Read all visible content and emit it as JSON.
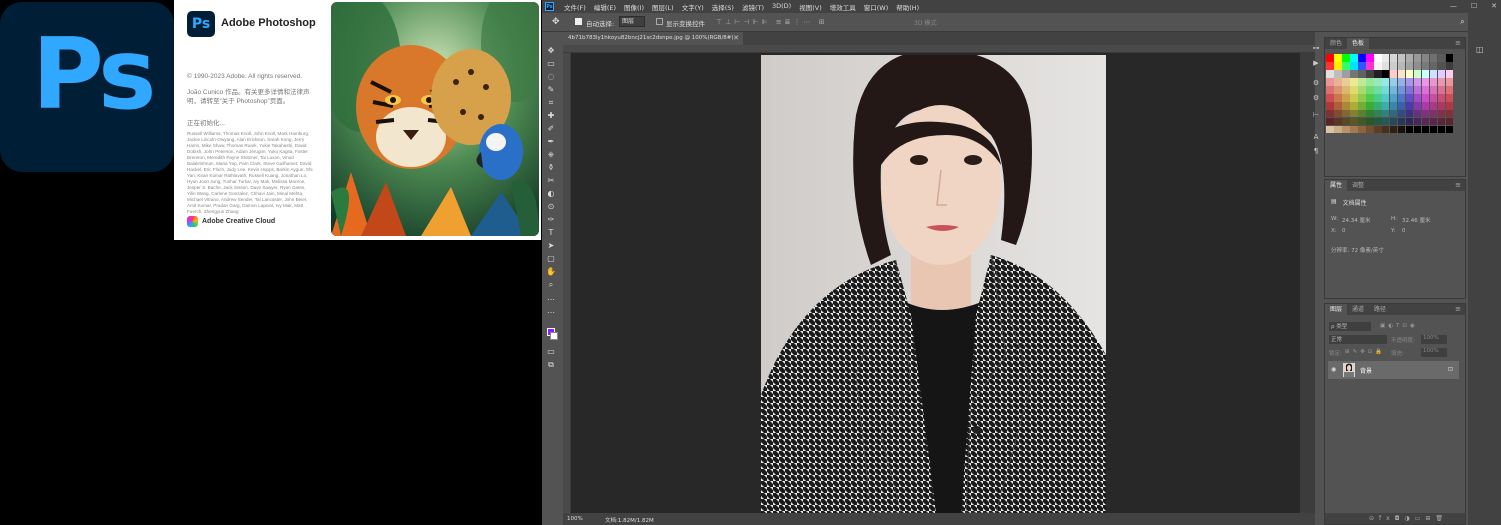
{
  "icon": {
    "text": "Ps",
    "color": "#31a8ff",
    "bg": "#001e36"
  },
  "splash": {
    "logo": "Ps",
    "title": "Adobe Photoshop",
    "copyright": "© 1990-2023 Adobe. All rights reserved.",
    "credit": "João Cunico 作品。有关更多详情和法律声明，请转至“关于 Photoshop”页面。",
    "status": "正在初始化...",
    "names": "Russell Williams, Thomas Knoll, John Knoll, Mark Hamburg, Jackie Lincoln-Owyang, Alan Erickson, Sarah Kong, Jerry Harris, Mike Shaw, Thomas Ruark, Yukie Takahashi, David Dobish, John Peterson, Adam Jerugim, Yuko Kagita, Foster Brereton, Meredith Payne Stotzner, Tai Luxon, Vinod Balakrishnan, Maria Yap, Pam Clark, Steve Guilhamet, David Hackel, Eric Floch, Judy Lee, Kevin Hopps, Barkin Aygun, Shi Yan, Kiran Kumar Rathlavath, Russell Kuang, Jonathan Lo, Hyun Joon Jung, Tushar Turkar, Ivy Mak, Melissa Monroe, Jesper S. Bache, Jack Sisson, Dave Sawyer, Ryan Gates, Yilin Wang, Carlene Gonzalez, Chhavi Jain, Minal Mehta, Michael Vitrano, Andrew Sender, Tal Lancaster, John Beier, Amit Kumar, Pradan Garg, Damon Lapoint, Ivy Mak, Matt Fuerch, Zhengyun Zhang",
    "cc": "Adobe Creative Cloud"
  },
  "menubar": {
    "logo": "Ps",
    "items": [
      "文件(F)",
      "编辑(E)",
      "图像(I)",
      "图层(L)",
      "文字(Y)",
      "选择(S)",
      "滤镜(T)",
      "3D(D)",
      "视图(V)",
      "增效工具",
      "窗口(W)",
      "帮助(H)"
    ],
    "controls": [
      "—",
      "☐",
      "✕"
    ]
  },
  "options": {
    "move_icon": "✥",
    "auto_select": "自动选择:",
    "layer_select": "图层",
    "show_transform": "显示变换控件",
    "align_icons": "⊤⊥⊢⊣⊩⊫ ≡≣⋮⋯ ⊞",
    "mode_3d": "3D 模式:",
    "right_icons": [
      "⌕",
      "◫",
      "⇪"
    ]
  },
  "tools": [
    "✥",
    "▭",
    "◌",
    "✎",
    "⌗",
    "✚",
    "✐",
    "✒",
    "⎈",
    "⚱",
    "✂",
    "◐",
    "⊙",
    "✑",
    "T",
    "➤",
    "▢",
    "✋",
    "⌕",
    "…"
  ],
  "document": {
    "tab": "4b71b783ly1hkoyu82bncj21sc2dsnpe.jpg @ 100%(RGB/8#)",
    "tab_close": "✕",
    "zoom": "100%",
    "doc_info": "文档:1.82M/1.82M"
  },
  "side_icons": [
    "⊶",
    "▶",
    "⚙",
    "⚙",
    "⊢",
    "A",
    "¶"
  ],
  "panels": {
    "swatches": {
      "tabs": [
        "颜色",
        "色板"
      ],
      "active": 1
    },
    "properties": {
      "tabs": [
        "属性",
        "调整"
      ],
      "title": "文档属性",
      "width_label": "W:",
      "width_value": "24.34 厘米",
      "height_label": "H:",
      "height_value": "32.46 厘米",
      "x_label": "X:",
      "x_value": "0",
      "y_label": "Y:",
      "y_value": "0",
      "resolution": "分辨率: 72 像素/英寸"
    },
    "layers": {
      "tabs": [
        "图层",
        "通道",
        "路径"
      ],
      "filter": "ρ 类型",
      "blend_mode": "正常",
      "opacity_label": "不透明度:",
      "opacity_value": "100%",
      "lock_label": "锁定:",
      "fill_label": "填充:",
      "fill_value": "100%",
      "layer_name": "背景"
    }
  },
  "colors": {
    "accent_ps": "#31a8ff",
    "fg": "#8a1cff",
    "bg": "#ffffff",
    "ui_bg": "#535353",
    "canvas_bg": "#282828"
  }
}
